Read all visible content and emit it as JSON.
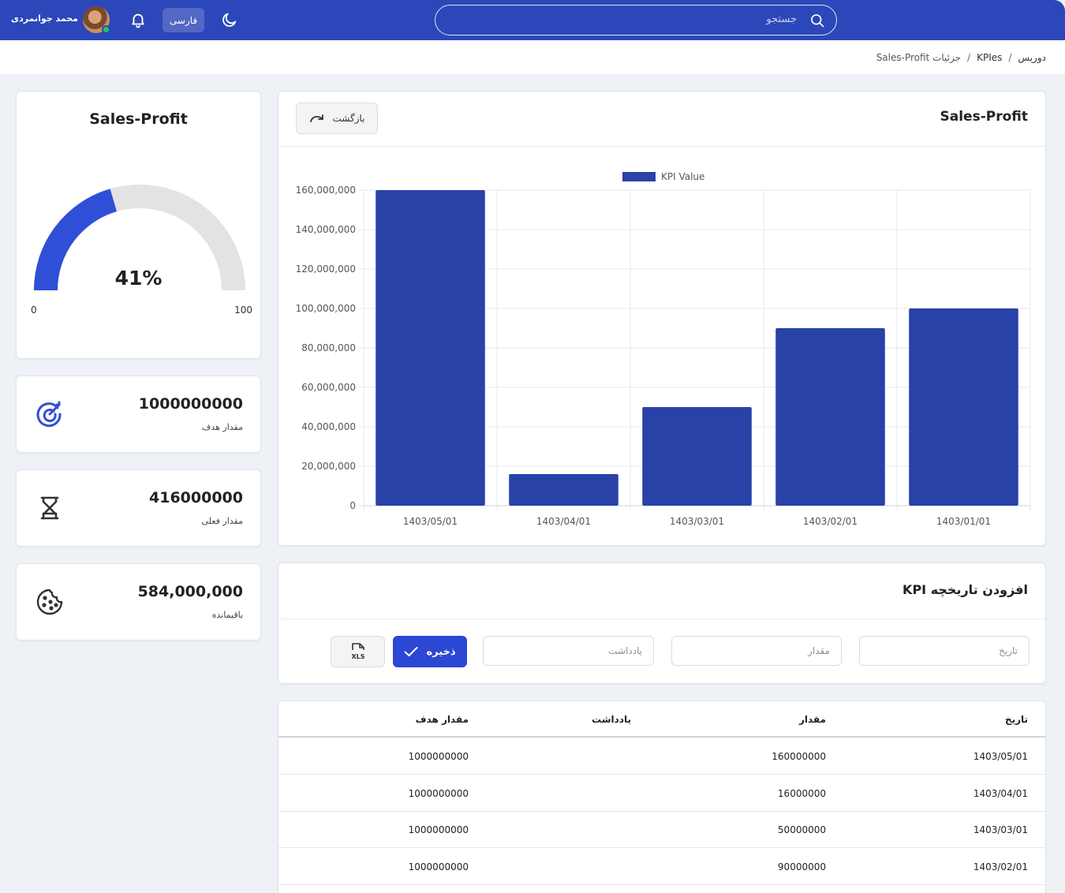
{
  "header": {
    "search_placeholder": "جستجو",
    "language_label": "فارسی",
    "user_name": "محمد جوانمردی"
  },
  "breadcrumb": {
    "items": [
      "دوریس",
      "KPIes",
      "جزئیات Sales-Profit"
    ],
    "separator": "/"
  },
  "gauge": {
    "title": "Sales-Profit",
    "percent_label": "41%",
    "percent_value": 41,
    "min_label": "0",
    "max_label": "100",
    "fill_color": "#2f4fd6",
    "track_color": "#e3e3e3"
  },
  "stats": [
    {
      "value": "1000000000",
      "label": "مقدار هدف",
      "icon": "target-icon"
    },
    {
      "value": "416000000",
      "label": "مقدار فعلی",
      "icon": "hourglass-icon"
    },
    {
      "value": "584,000,000",
      "label": "باقیمانده",
      "icon": "cookie-icon"
    }
  ],
  "chart_card": {
    "title": "Sales-Profit",
    "back_label": "بازگشت"
  },
  "chart_data": {
    "type": "bar",
    "categories": [
      "1403/05/01",
      "1403/04/01",
      "1403/03/01",
      "1403/02/01",
      "1403/01/01"
    ],
    "series": [
      {
        "name": "KPI Value",
        "values": [
          160000000,
          16000000,
          50000000,
          90000000,
          100000000
        ]
      }
    ],
    "ylim": [
      0,
      160000000
    ],
    "yticks": [
      "0",
      "20,000,000",
      "40,000,000",
      "60,000,000",
      "80,000,000",
      "100,000,000",
      "120,000,000",
      "140,000,000",
      "160,000,000"
    ],
    "bar_color": "#2942a8",
    "legend_position": "top-center",
    "grid": true
  },
  "form": {
    "title": "افزودن تاریخچه KPI",
    "date_placeholder": "تاریخ",
    "amount_placeholder": "مقدار",
    "note_placeholder": "یادداشت",
    "save_label": "ذخیره",
    "export_label": "XLS"
  },
  "table": {
    "headers": {
      "date": "تاریخ",
      "amount": "مقدار",
      "note": "یادداشت",
      "target": "مقدار هدف"
    },
    "rows": [
      {
        "date": "1403/05/01",
        "amount": "160000000",
        "note": "",
        "target": "1000000000"
      },
      {
        "date": "1403/04/01",
        "amount": "16000000",
        "note": "",
        "target": "1000000000"
      },
      {
        "date": "1403/03/01",
        "amount": "50000000",
        "note": "",
        "target": "1000000000"
      },
      {
        "date": "1403/02/01",
        "amount": "90000000",
        "note": "",
        "target": "1000000000"
      }
    ]
  }
}
